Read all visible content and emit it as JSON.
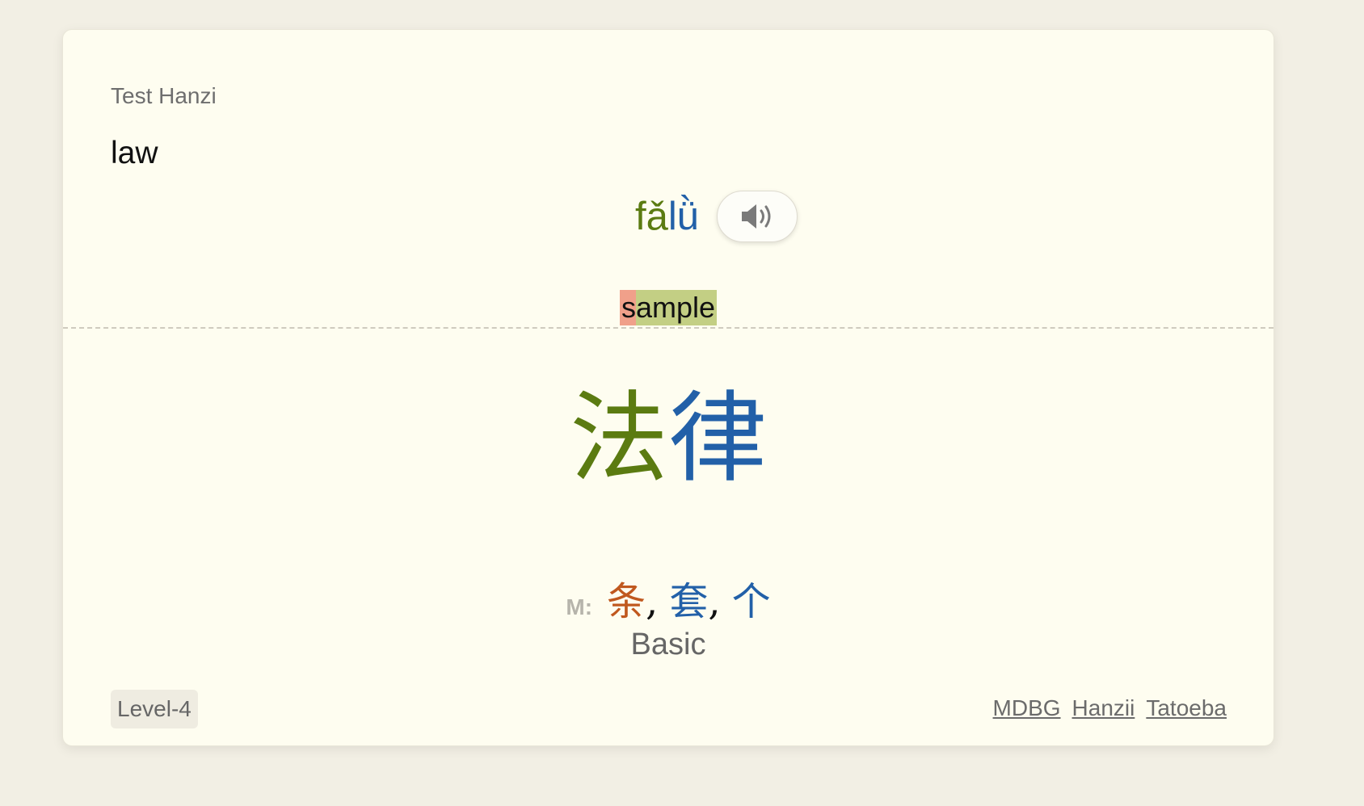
{
  "card": {
    "deck_name": "Test Hanzi",
    "meaning": "law",
    "pinyin": [
      {
        "text": "fǎ",
        "tone": 3
      },
      {
        "text": "lǜ",
        "tone": 4
      }
    ],
    "audio_icon": "speaker-icon",
    "sample": {
      "part1": "s",
      "part2": "ample"
    },
    "hanzi": [
      {
        "char": "法",
        "tone": 3
      },
      {
        "char": "律",
        "tone": 4
      }
    ],
    "measure_label": "M:",
    "measure_words": [
      {
        "char": "条",
        "tone": 2
      },
      {
        "char": "套",
        "tone": 4
      },
      {
        "char": "个",
        "tone": 4
      }
    ],
    "comma": ",",
    "category": "Basic",
    "tag": "Level-4",
    "links": [
      "MDBG",
      "Hanzii",
      "Tatoeba"
    ]
  },
  "colors": {
    "tone2": "#c0581e",
    "tone3": "#5b7b11",
    "tone4": "#2260a8",
    "background": "#f2efe4",
    "card": "#fefdf0"
  }
}
